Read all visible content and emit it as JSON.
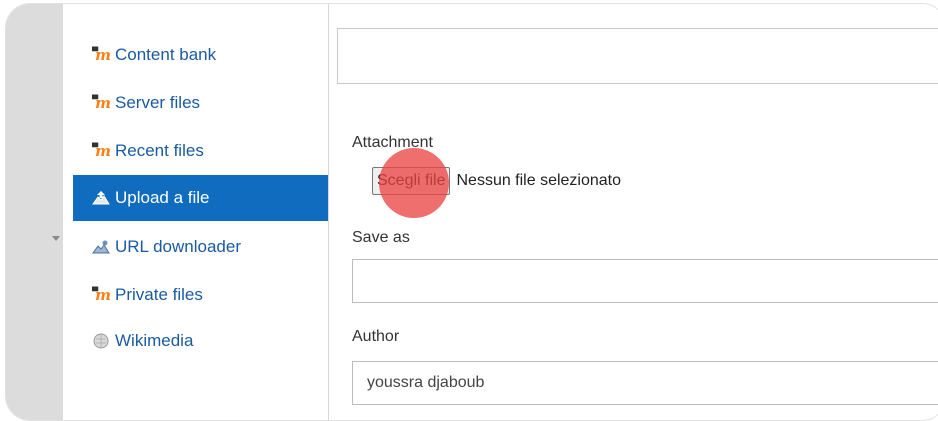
{
  "sidebar": {
    "items": [
      {
        "label": "Content bank",
        "icon": "moodle-icon",
        "active": false
      },
      {
        "label": "Server files",
        "icon": "moodle-icon",
        "active": false
      },
      {
        "label": "Recent files",
        "icon": "moodle-icon",
        "active": false
      },
      {
        "label": "Upload a file",
        "icon": "upload-icon",
        "active": true
      },
      {
        "label": "URL downloader",
        "icon": "url-downloader-icon",
        "active": false
      },
      {
        "label": "Private files",
        "icon": "moodle-icon",
        "active": false
      },
      {
        "label": "Wikimedia",
        "icon": "wikimedia-icon",
        "active": false
      }
    ]
  },
  "form": {
    "attachment_label": "Attachment",
    "choose_button": "Scegli file",
    "file_status": "Nessun file selezionato",
    "save_as_label": "Save as",
    "save_as_value": "",
    "author_label": "Author",
    "author_value": "youssra djaboub"
  },
  "colors": {
    "active_bg": "#0f6cbf",
    "link": "#1a5aa3",
    "moodle_orange": "#f98012",
    "click_indicator": "#eb4646"
  }
}
